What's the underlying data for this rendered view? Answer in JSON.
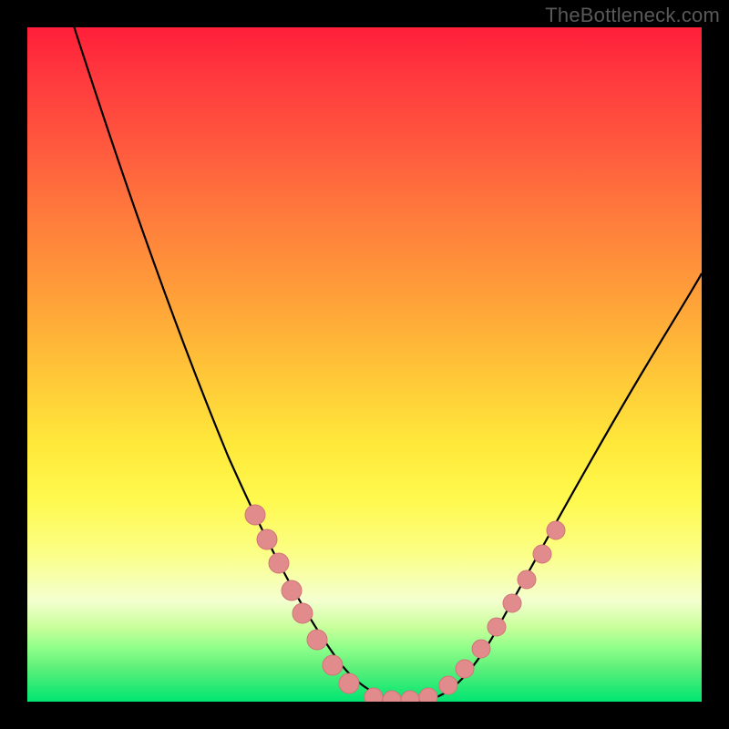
{
  "attribution": "TheBottleneck.com",
  "chart_data": {
    "type": "line",
    "title": "",
    "xlabel": "",
    "ylabel": "",
    "xlim": [
      0,
      100
    ],
    "ylim": [
      0,
      100
    ],
    "x": [
      5,
      10,
      15,
      20,
      25,
      30,
      35,
      40,
      42,
      45,
      48,
      50,
      55,
      60,
      65,
      70,
      75,
      80,
      85,
      90,
      95,
      100
    ],
    "values": [
      100,
      88,
      76,
      64,
      53,
      42,
      32,
      22,
      18,
      12,
      6,
      3,
      0,
      0,
      3,
      8,
      14,
      22,
      30,
      39,
      48,
      58
    ],
    "note": "Single V-shaped curve; values estimated from pixel heights relative to plot area (0 at bottom, 100 at top of gradient region). No axis ticks or labels shown.",
    "markers": {
      "left_branch_x": [
        35,
        37,
        38,
        40,
        42,
        45,
        48,
        50
      ],
      "left_branch_y": [
        32,
        28,
        25,
        22,
        18,
        12,
        6,
        3
      ],
      "right_branch_x": [
        60,
        62,
        65,
        67,
        70,
        72,
        75,
        77
      ],
      "right_branch_y": [
        0,
        4,
        8,
        11,
        14,
        18,
        22,
        25
      ]
    }
  },
  "colors": {
    "frame": "#000000",
    "curve": "#000000",
    "dots": "#e28b8c",
    "attribution": "#595959"
  }
}
